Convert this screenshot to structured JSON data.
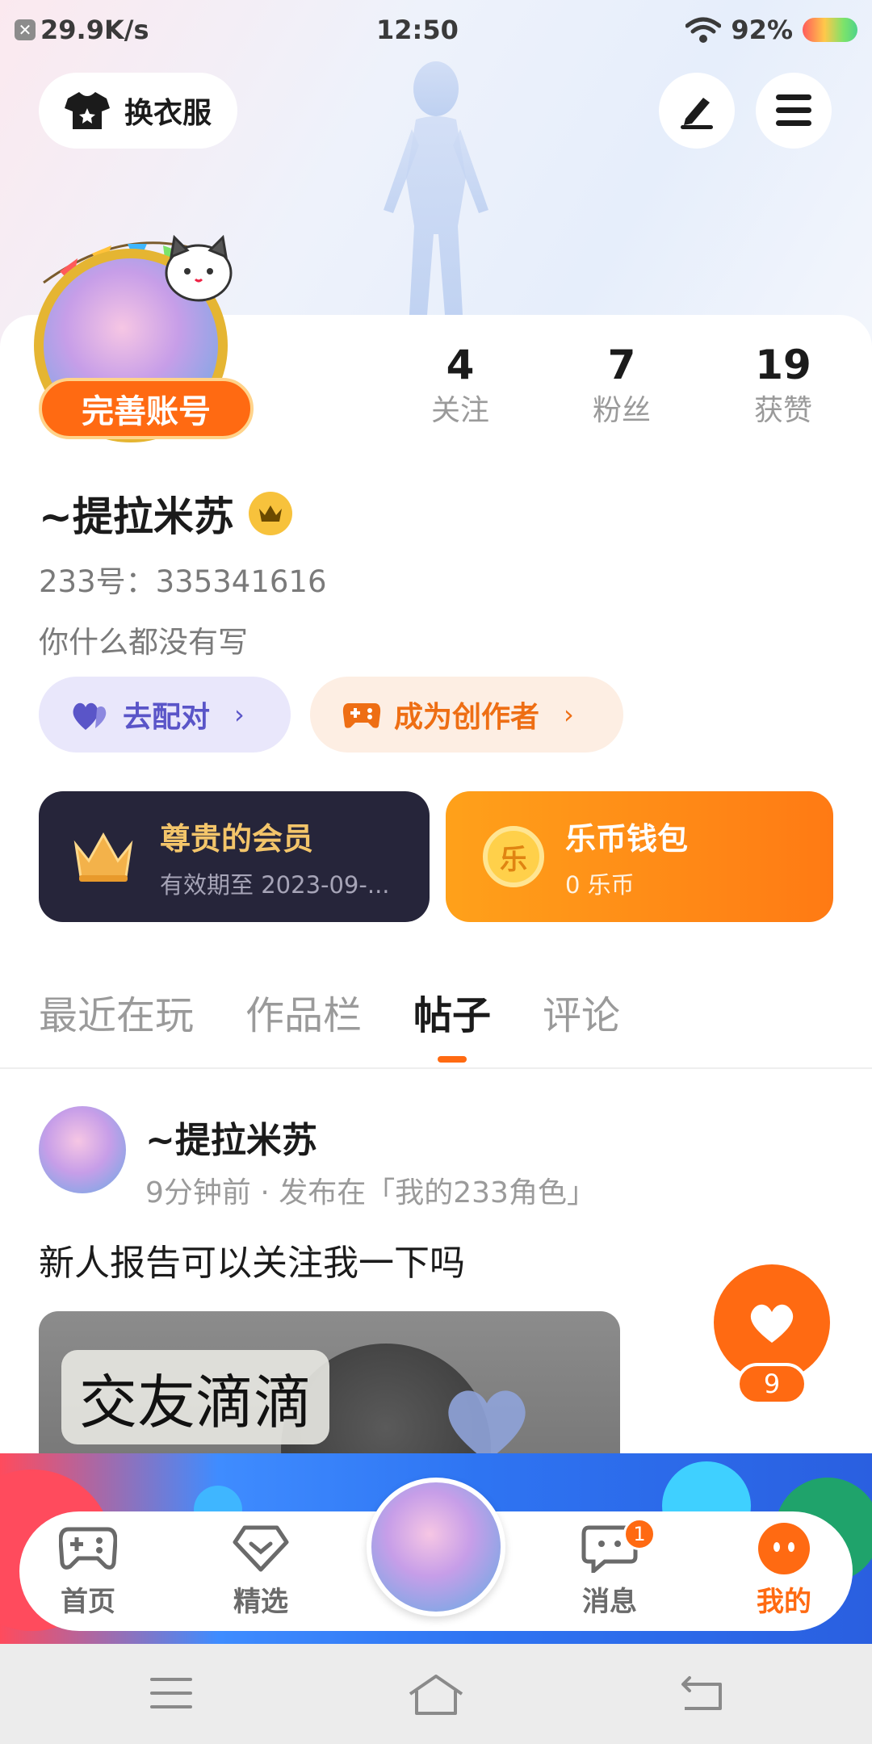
{
  "status_bar": {
    "network_speed": "29.9K/s",
    "time": "12:50",
    "battery": "92%"
  },
  "header": {
    "outfit_label": "换衣服",
    "edit_icon": "pen-icon",
    "menu_icon": "hamburger-icon"
  },
  "profile": {
    "perfect_badge": "完善账号",
    "stats": [
      {
        "value": "4",
        "label": "关注"
      },
      {
        "value": "7",
        "label": "粉丝"
      },
      {
        "value": "19",
        "label": "获赞"
      }
    ],
    "name": "~提拉米苏",
    "uid": "233号：335341616",
    "bio": "你什么都没有写",
    "match_label": "去配对",
    "creator_label": "成为创作者"
  },
  "vip": {
    "title": "尊贵的会员",
    "subtitle": "有效期至 2023-09-..."
  },
  "wallet": {
    "coin_glyph": "乐",
    "title": "乐币钱包",
    "subtitle": "0 乐币"
  },
  "tabs": [
    {
      "label": "最近在玩"
    },
    {
      "label": "作品栏"
    },
    {
      "label": "帖子"
    },
    {
      "label": "评论"
    }
  ],
  "active_tab": "帖子",
  "post": {
    "author": "~提拉米苏",
    "meta": "9分钟前 · 发布在「我的233角色」",
    "text": "新人报告可以关注我一下吗",
    "image_caption": "交友滴滴",
    "like_count": "9"
  },
  "bottom_nav": {
    "items": [
      {
        "label": "首页"
      },
      {
        "label": "精选"
      },
      {
        "label": "消息"
      },
      {
        "label": "我的"
      }
    ],
    "message_badge": "1"
  },
  "colors": {
    "accent": "#ff6a12",
    "vip_bg": "#26253a",
    "vip_gold": "#f3c56a",
    "match_purple": "#5a55c8"
  }
}
